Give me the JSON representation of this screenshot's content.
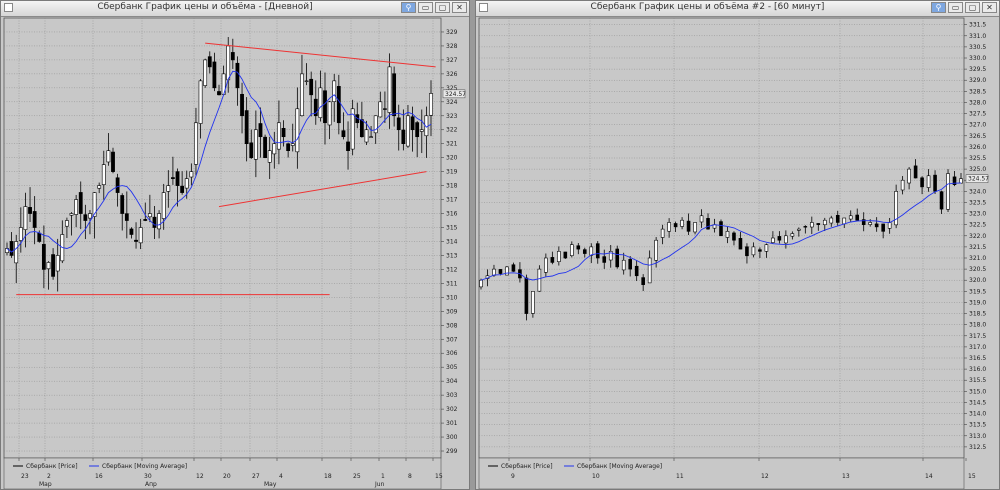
{
  "windows": [
    {
      "title": "Сбербанк График цены и объёма - [Дневной]",
      "buttons": [
        "pin-icon",
        "minimize-icon",
        "maximize-icon",
        "close-icon"
      ]
    },
    {
      "title": "Сбербанк График цены и объёма #2 - [60 минут]",
      "buttons": [
        "pin-icon",
        "minimize-icon",
        "maximize-icon",
        "close-icon"
      ]
    }
  ],
  "colors": {
    "candle": "#000000",
    "ma": "#2233ee",
    "trend": "#ee3333",
    "grid": "#8c8c8c",
    "plot_bg": "#c8c8c8"
  },
  "chart_data": [
    {
      "type": "candlestick",
      "timeframe": "Дневной",
      "ylim": [
        298.5,
        330
      ],
      "y_ticks": [
        299,
        300,
        301,
        302,
        303,
        304,
        305,
        306,
        307,
        308,
        309,
        310,
        311,
        312,
        313,
        314,
        315,
        316,
        317,
        318,
        319,
        320,
        321,
        322,
        323,
        324,
        325,
        326,
        327,
        328,
        329
      ],
      "last_price_label": "324.57",
      "x_ticks": [
        "23",
        "2",
        "16",
        "30",
        "12",
        "20",
        "27",
        "4",
        "18",
        "25",
        "1",
        "8",
        "15"
      ],
      "x_months": [
        "Мар",
        "Апр",
        "May",
        "Jun"
      ],
      "legend": [
        "Сбербанк [Price]",
        "Сбербанк [Moving Average]"
      ],
      "series": [
        {
          "name": "Сбербанк [Price]",
          "close": [
            313.5,
            313.0,
            314.0,
            315.0,
            316.5,
            316.0,
            315.0,
            314.0,
            312.0,
            312.5,
            311.5,
            313.0,
            314.5,
            315.5,
            316.0,
            317.0,
            316.0,
            315.5,
            316.0,
            317.5,
            318.0,
            319.5,
            320.5,
            319.0,
            317.5,
            316.0,
            315.5,
            314.5,
            314.0,
            315.0,
            315.5,
            316.0,
            315.0,
            316.0,
            317.5,
            318.0,
            318.5,
            318.0,
            317.5,
            318.5,
            319.0,
            322.5,
            325.5,
            327.0,
            326.5,
            325.0,
            324.5,
            326.0,
            328.0,
            327.0,
            325.0,
            323.0,
            321.0,
            320.0,
            322.0,
            321.5,
            320.0,
            320.5,
            321.0,
            322.5,
            321.5,
            320.5,
            321.0,
            323.5,
            326.0,
            325.5,
            324.5,
            323.0,
            325.0,
            322.5,
            324.0,
            325.5,
            322.5,
            321.5,
            320.5,
            323.5,
            322.5,
            321.5,
            322.0,
            321.5,
            323.0,
            324.0,
            323.5,
            326.5,
            323.0,
            322.0,
            321.0,
            323.0,
            322.0,
            321.5,
            322.0,
            323.0,
            324.6
          ]
        },
        {
          "name": "Сбербанк [Moving Average]"
        }
      ],
      "trendlines": [
        {
          "points": [
            [
              43,
              328.2
            ],
            [
              93,
              326.5
            ]
          ]
        },
        {
          "points": [
            [
              46,
              316.5
            ],
            [
              91,
              319.0
            ]
          ]
        },
        {
          "points": [
            [
              2,
              310.2
            ],
            [
              70,
              310.2
            ]
          ]
        }
      ]
    },
    {
      "type": "candlestick",
      "timeframe": "60 минут",
      "ylim": [
        312.0,
        331.8
      ],
      "y_ticks": [
        312.5,
        313.0,
        313.5,
        314.0,
        314.5,
        315.0,
        315.5,
        316.0,
        316.5,
        317.0,
        317.5,
        318.0,
        318.5,
        319.0,
        319.5,
        320.0,
        320.5,
        321.0,
        321.5,
        322.0,
        322.5,
        323.0,
        323.5,
        324.0,
        324.5,
        325.0,
        325.5,
        326.0,
        326.5,
        327.0,
        327.5,
        328.0,
        328.5,
        329.0,
        329.5,
        330.0,
        330.5,
        331.0,
        331.5
      ],
      "last_price_label": "324.57",
      "x_ticks": [
        "9",
        "10",
        "11",
        "12",
        "13",
        "14",
        "15"
      ],
      "legend": [
        "Сбербанк [Price]",
        "Сбербанк [Moving Average]"
      ],
      "series": [
        {
          "name": "Сбербанк [Price]",
          "close": [
            320.0,
            320.2,
            320.5,
            320.3,
            320.6,
            320.4,
            320.1,
            318.5,
            319.5,
            320.5,
            321.0,
            320.8,
            321.3,
            321.0,
            321.6,
            321.4,
            321.2,
            321.5,
            321.0,
            320.8,
            321.3,
            320.6,
            320.9,
            320.5,
            320.2,
            319.8,
            321.0,
            321.8,
            322.3,
            322.6,
            322.4,
            322.7,
            322.2,
            322.6,
            322.9,
            322.3,
            322.5,
            322.0,
            322.2,
            321.8,
            321.4,
            321.1,
            321.5,
            321.3,
            321.6,
            321.9,
            321.8,
            322.0,
            322.1,
            322.3,
            322.4,
            322.6,
            322.5,
            322.7,
            322.8,
            322.6,
            322.8,
            322.9,
            322.7,
            322.5,
            322.6,
            322.4,
            322.2,
            322.6,
            324.0,
            324.5,
            325.0,
            324.6,
            324.2,
            324.7,
            324.0,
            323.2,
            324.8,
            324.3,
            324.57
          ]
        },
        {
          "name": "Сбербанк [Moving Average]"
        }
      ]
    }
  ]
}
